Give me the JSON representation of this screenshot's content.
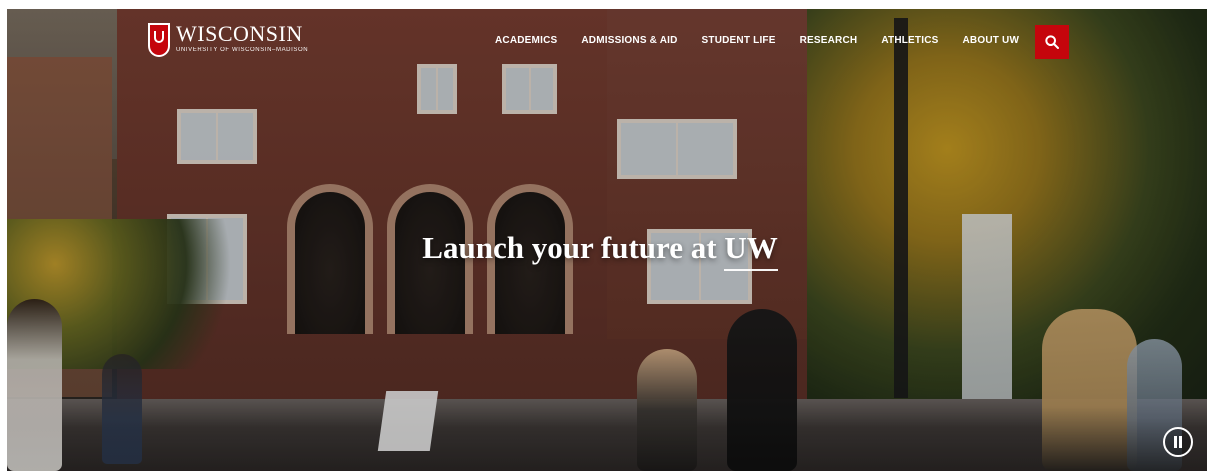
{
  "brand": {
    "name": "WISCONSIN",
    "subtitle": "UNIVERSITY OF WISCONSIN–MADISON"
  },
  "nav": {
    "items": [
      {
        "label": "ACADEMICS"
      },
      {
        "label": "ADMISSIONS & AID"
      },
      {
        "label": "STUDENT LIFE"
      },
      {
        "label": "RESEARCH"
      },
      {
        "label": "ATHLETICS"
      },
      {
        "label": "ABOUT UW"
      }
    ]
  },
  "hero": {
    "headline_prefix": "Launch your future at ",
    "headline_emphasis": "UW"
  },
  "colors": {
    "accent": "#c5050c"
  },
  "icons": {
    "search": "search-icon",
    "pause": "pause-icon",
    "crest": "crest-icon"
  }
}
